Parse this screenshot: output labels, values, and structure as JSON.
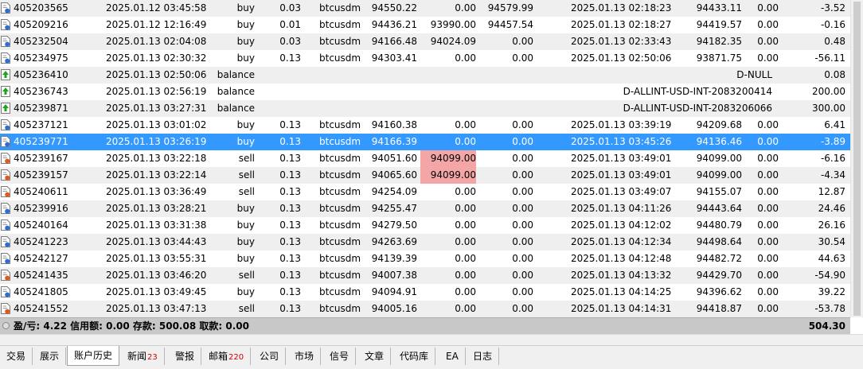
{
  "rows": [
    {
      "ticket": "405203565",
      "open_time": "2025.01.12 03:45:58",
      "type": "buy",
      "volume": "0.03",
      "symbol": "btcusdm",
      "price": "94550.22",
      "sl": "0.00",
      "tp": "94579.99",
      "close_time": "2025.01.13 02:18:23",
      "close_price": "94433.11",
      "swap": "0.00",
      "profit": "-3.52",
      "icon": "buy-order-icon"
    },
    {
      "ticket": "405209216",
      "open_time": "2025.01.12 12:16:49",
      "type": "buy",
      "volume": "0.01",
      "symbol": "btcusdm",
      "price": "94436.21",
      "sl": "93990.00",
      "tp": "94457.54",
      "close_time": "2025.01.13 02:18:27",
      "close_price": "94419.57",
      "swap": "0.00",
      "profit": "-0.16",
      "icon": "buy-order-icon"
    },
    {
      "ticket": "405232504",
      "open_time": "2025.01.13 02:04:08",
      "type": "buy",
      "volume": "0.03",
      "symbol": "btcusdm",
      "price": "94166.48",
      "sl": "94024.09",
      "tp": "0.00",
      "close_time": "2025.01.13 02:33:43",
      "close_price": "94182.35",
      "swap": "0.00",
      "profit": "0.48",
      "icon": "buy-order-icon"
    },
    {
      "ticket": "405234975",
      "open_time": "2025.01.13 02:30:32",
      "type": "buy",
      "volume": "0.13",
      "symbol": "btcusdm",
      "price": "94303.41",
      "sl": "0.00",
      "tp": "0.00",
      "close_time": "2025.01.13 02:50:06",
      "close_price": "93871.75",
      "swap": "0.00",
      "profit": "-56.11",
      "icon": "buy-order-icon"
    },
    {
      "ticket": "405236410",
      "open_time": "2025.01.13 02:50:06",
      "type": "balance",
      "comment": "D-NULL",
      "profit": "0.08",
      "icon": "balance-icon"
    },
    {
      "ticket": "405236743",
      "open_time": "2025.01.13 02:56:19",
      "type": "balance",
      "comment": "D-ALLINT-USD-INT-2083200414",
      "profit": "200.00",
      "icon": "balance-icon"
    },
    {
      "ticket": "405239871",
      "open_time": "2025.01.13 03:27:31",
      "type": "balance",
      "comment": "D-ALLINT-USD-INT-2083206066",
      "profit": "300.00",
      "icon": "balance-icon"
    },
    {
      "ticket": "405237121",
      "open_time": "2025.01.13 03:01:02",
      "type": "buy",
      "volume": "0.13",
      "symbol": "btcusdm",
      "price": "94160.38",
      "sl": "0.00",
      "tp": "0.00",
      "close_time": "2025.01.13 03:39:19",
      "close_price": "94209.68",
      "swap": "0.00",
      "profit": "6.41",
      "icon": "buy-order-icon"
    },
    {
      "ticket": "405239771",
      "open_time": "2025.01.13 03:26:19",
      "type": "buy",
      "volume": "0.13",
      "symbol": "btcusdm",
      "price": "94166.39",
      "sl": "0.00",
      "tp": "0.00",
      "close_time": "2025.01.13 03:45:26",
      "close_price": "94136.46",
      "swap": "0.00",
      "profit": "-3.89",
      "icon": "buy-order-icon",
      "selected": true
    },
    {
      "ticket": "405239167",
      "open_time": "2025.01.13 03:22:18",
      "type": "sell",
      "volume": "0.13",
      "symbol": "btcusdm",
      "price": "94051.60",
      "sl": "94099.00",
      "tp": "0.00",
      "close_time": "2025.01.13 03:49:01",
      "close_price": "94099.00",
      "swap": "0.00",
      "profit": "-6.16",
      "icon": "sell-order-icon",
      "sl_hit": true
    },
    {
      "ticket": "405239157",
      "open_time": "2025.01.13 03:22:14",
      "type": "sell",
      "volume": "0.13",
      "symbol": "btcusdm",
      "price": "94065.60",
      "sl": "94099.00",
      "tp": "0.00",
      "close_time": "2025.01.13 03:49:01",
      "close_price": "94099.00",
      "swap": "0.00",
      "profit": "-4.34",
      "icon": "sell-order-icon",
      "sl_hit": true
    },
    {
      "ticket": "405240611",
      "open_time": "2025.01.13 03:36:49",
      "type": "sell",
      "volume": "0.13",
      "symbol": "btcusdm",
      "price": "94254.09",
      "sl": "0.00",
      "tp": "0.00",
      "close_time": "2025.01.13 03:49:07",
      "close_price": "94155.07",
      "swap": "0.00",
      "profit": "12.87",
      "icon": "sell-order-icon"
    },
    {
      "ticket": "405239916",
      "open_time": "2025.01.13 03:28:21",
      "type": "buy",
      "volume": "0.13",
      "symbol": "btcusdm",
      "price": "94255.47",
      "sl": "0.00",
      "tp": "0.00",
      "close_time": "2025.01.13 04:11:26",
      "close_price": "94443.64",
      "swap": "0.00",
      "profit": "24.46",
      "icon": "buy-order-icon"
    },
    {
      "ticket": "405240164",
      "open_time": "2025.01.13 03:31:38",
      "type": "buy",
      "volume": "0.13",
      "symbol": "btcusdm",
      "price": "94279.50",
      "sl": "0.00",
      "tp": "0.00",
      "close_time": "2025.01.13 04:12:02",
      "close_price": "94480.79",
      "swap": "0.00",
      "profit": "26.16",
      "icon": "buy-order-icon"
    },
    {
      "ticket": "405241223",
      "open_time": "2025.01.13 03:44:43",
      "type": "buy",
      "volume": "0.13",
      "symbol": "btcusdm",
      "price": "94263.69",
      "sl": "0.00",
      "tp": "0.00",
      "close_time": "2025.01.13 04:12:34",
      "close_price": "94498.64",
      "swap": "0.00",
      "profit": "30.54",
      "icon": "buy-order-icon"
    },
    {
      "ticket": "405242127",
      "open_time": "2025.01.13 03:55:31",
      "type": "buy",
      "volume": "0.13",
      "symbol": "btcusdm",
      "price": "94139.39",
      "sl": "0.00",
      "tp": "0.00",
      "close_time": "2025.01.13 04:12:48",
      "close_price": "94482.72",
      "swap": "0.00",
      "profit": "44.63",
      "icon": "buy-order-icon"
    },
    {
      "ticket": "405241435",
      "open_time": "2025.01.13 03:46:20",
      "type": "sell",
      "volume": "0.13",
      "symbol": "btcusdm",
      "price": "94007.38",
      "sl": "0.00",
      "tp": "0.00",
      "close_time": "2025.01.13 04:13:32",
      "close_price": "94429.70",
      "swap": "0.00",
      "profit": "-54.90",
      "icon": "sell-order-icon"
    },
    {
      "ticket": "405241805",
      "open_time": "2025.01.13 03:49:45",
      "type": "buy",
      "volume": "0.13",
      "symbol": "btcusdm",
      "price": "94094.91",
      "sl": "0.00",
      "tp": "0.00",
      "close_time": "2025.01.13 04:14:25",
      "close_price": "94396.62",
      "swap": "0.00",
      "profit": "39.22",
      "icon": "buy-order-icon"
    },
    {
      "ticket": "405241552",
      "open_time": "2025.01.13 03:47:13",
      "type": "sell",
      "volume": "0.13",
      "symbol": "btcusdm",
      "price": "94005.16",
      "sl": "0.00",
      "tp": "0.00",
      "close_time": "2025.01.13 04:14:31",
      "close_price": "94418.87",
      "swap": "0.00",
      "profit": "-53.78",
      "icon": "sell-order-icon"
    }
  ],
  "summary": {
    "text": "盈/亏: 4.22  信用额: 0.00  存款: 500.08  取款: 0.00",
    "total": "504.30"
  },
  "tabs": [
    {
      "label": "交易",
      "badge": "",
      "name": "tab-trade"
    },
    {
      "label": "展示",
      "badge": "",
      "name": "tab-exposure"
    },
    {
      "label": "账户历史",
      "badge": "",
      "name": "tab-account-history",
      "active": true
    },
    {
      "label": "新闻",
      "badge": "23",
      "name": "tab-news"
    },
    {
      "label": "警报",
      "badge": "",
      "name": "tab-alerts"
    },
    {
      "label": "邮箱",
      "badge": "220",
      "name": "tab-mailbox"
    },
    {
      "label": "公司",
      "badge": "",
      "name": "tab-company"
    },
    {
      "label": "市场",
      "badge": "",
      "name": "tab-market"
    },
    {
      "label": "信号",
      "badge": "",
      "name": "tab-signals"
    },
    {
      "label": "文章",
      "badge": "",
      "name": "tab-articles"
    },
    {
      "label": "代码库",
      "badge": "",
      "name": "tab-code-base"
    },
    {
      "label": "EA",
      "badge": "",
      "name": "tab-ea"
    },
    {
      "label": "日志",
      "badge": "",
      "name": "tab-journal"
    }
  ],
  "colors": {
    "selected_row": "#3399ff",
    "sl_hit_highlight": "#f4a6a6",
    "badge": "#d20000"
  }
}
